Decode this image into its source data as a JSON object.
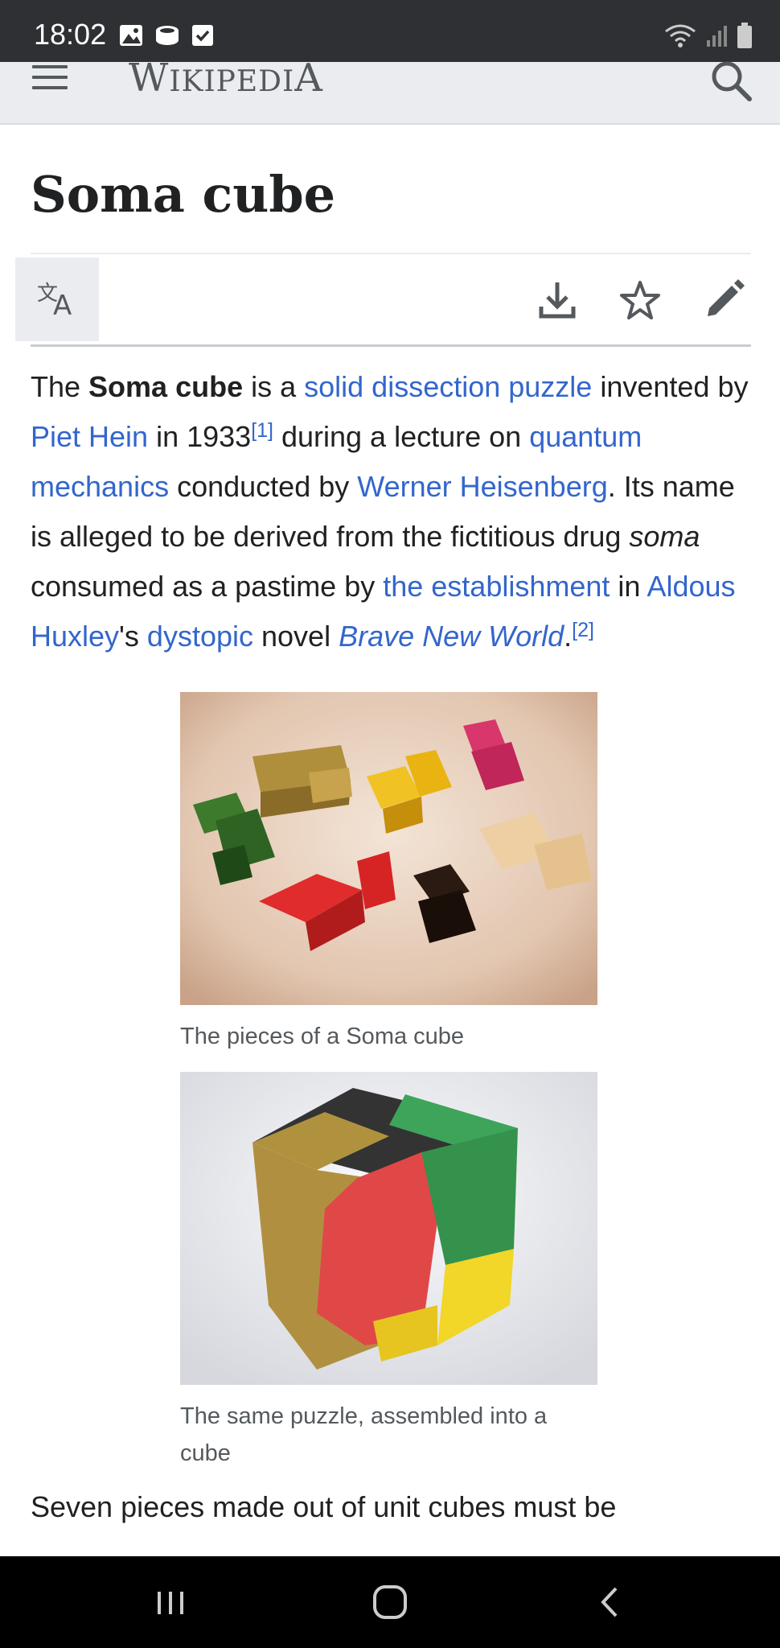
{
  "status_bar": {
    "time": "18:02",
    "notification_icons": [
      "image-icon",
      "sync-icon",
      "checkbox-icon"
    ],
    "system_icons": [
      "wifi-icon",
      "signal-icon",
      "battery-icon"
    ]
  },
  "header": {
    "logo_first": "W",
    "logo_rest": "IKIPEDI",
    "logo_last": "A",
    "menu_icon": "menu-icon",
    "search_icon": "search-icon"
  },
  "article": {
    "title": "Soma cube",
    "actions": [
      "language-icon",
      "download-icon",
      "star-icon",
      "edit-icon"
    ],
    "intro": {
      "t1": "The ",
      "b1": "Soma cube",
      "t2": " is a ",
      "l1": "solid dissection puzzle",
      "t3": " invented by ",
      "l2": "Piet Hein",
      "t4": " in 1933",
      "r1": "[1]",
      "t5": " during a lecture on ",
      "l3": "quantum mechanics",
      "t6": " conducted by ",
      "l4": "Werner Heisenberg",
      "t7": ". Its name is alleged to be derived from the fictitious drug ",
      "i1": "soma",
      "t8": " consumed as a pastime by ",
      "l5": "the establishment",
      "t9": " in ",
      "l6": "Aldous Huxley",
      "t10": "'s ",
      "l7": "dystopic",
      "t11": " novel ",
      "l8": "Brave New World",
      "t12": ".",
      "r2": "[2]"
    },
    "figures": [
      {
        "caption": "The pieces of a Soma cube"
      },
      {
        "caption": "The same puzzle, assembled into a cube"
      }
    ],
    "next_paragraph": "Seven pieces made out of unit cubes must be"
  },
  "nav_bar": {
    "buttons": [
      "recent-apps-icon",
      "home-icon",
      "back-icon"
    ]
  },
  "colors": {
    "link": "#3366cc",
    "text": "#202122",
    "header_bg": "#eaecf0",
    "status_bar": "#2f3033"
  }
}
